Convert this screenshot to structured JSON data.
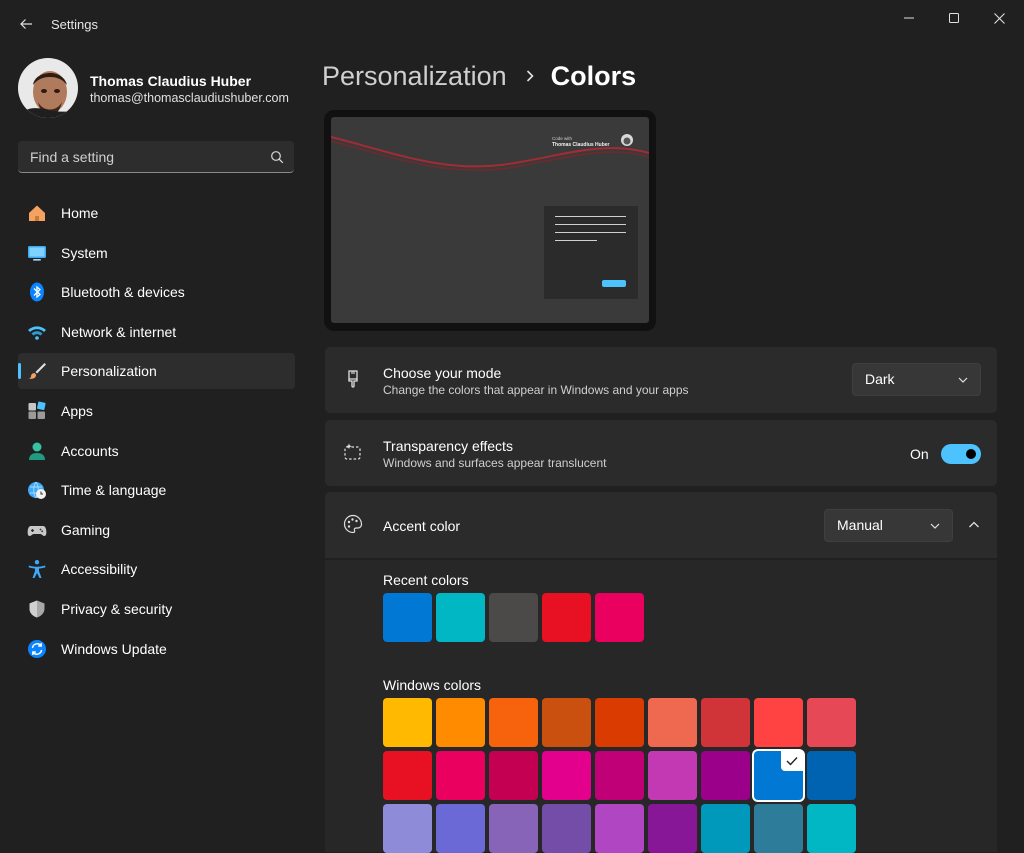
{
  "app": {
    "title": "Settings"
  },
  "profile": {
    "name": "Thomas Claudius Huber",
    "email": "thomas@thomasclaudiushuber.com"
  },
  "search": {
    "placeholder": "Find a setting"
  },
  "nav": {
    "items": [
      {
        "label": "Home",
        "icon": "home-icon"
      },
      {
        "label": "System",
        "icon": "monitor-icon"
      },
      {
        "label": "Bluetooth & devices",
        "icon": "bluetooth-icon"
      },
      {
        "label": "Network & internet",
        "icon": "wifi-icon"
      },
      {
        "label": "Personalization",
        "icon": "paintbrush-icon",
        "selected": true
      },
      {
        "label": "Apps",
        "icon": "apps-icon"
      },
      {
        "label": "Accounts",
        "icon": "person-icon"
      },
      {
        "label": "Time & language",
        "icon": "globe-clock-icon"
      },
      {
        "label": "Gaming",
        "icon": "gamepad-icon"
      },
      {
        "label": "Accessibility",
        "icon": "accessibility-icon"
      },
      {
        "label": "Privacy & security",
        "icon": "shield-icon"
      },
      {
        "label": "Windows Update",
        "icon": "update-icon"
      }
    ]
  },
  "breadcrumb": {
    "parent": "Personalization",
    "current": "Colors"
  },
  "preview": {
    "brand_small": "Code with",
    "brand_name": "Thomas Claudius Huber"
  },
  "mode": {
    "title": "Choose your mode",
    "subtitle": "Change the colors that appear in Windows and your apps",
    "value": "Dark"
  },
  "transparency": {
    "title": "Transparency effects",
    "subtitle": "Windows and surfaces appear translucent",
    "state_label": "On",
    "enabled": true
  },
  "accent": {
    "title": "Accent color",
    "value": "Manual",
    "recent_label": "Recent colors",
    "recent_colors": [
      "#0078d4",
      "#00b7c3",
      "#4c4a48",
      "#e81123",
      "#ea005e"
    ],
    "windows_label": "Windows colors",
    "windows_colors": [
      [
        "#ffb900",
        "#ff8c00",
        "#f7630c",
        "#ca5010",
        "#da3b01",
        "#ef6950",
        "#d13438",
        "#ff4343",
        "#e74856"
      ],
      [
        "#e81123",
        "#ea005e",
        "#c30052",
        "#e3008c",
        "#bf0077",
        "#c239b3",
        "#9a0089",
        "#0078d4",
        "#0063b1"
      ],
      [
        "#8e8cd8",
        "#6b69d6",
        "#8764b8",
        "#744da9",
        "#b146c2",
        "#881798",
        "#0099bc",
        "#2d7d9a",
        "#00b7c3"
      ]
    ],
    "selected_color": "#0078d4"
  }
}
